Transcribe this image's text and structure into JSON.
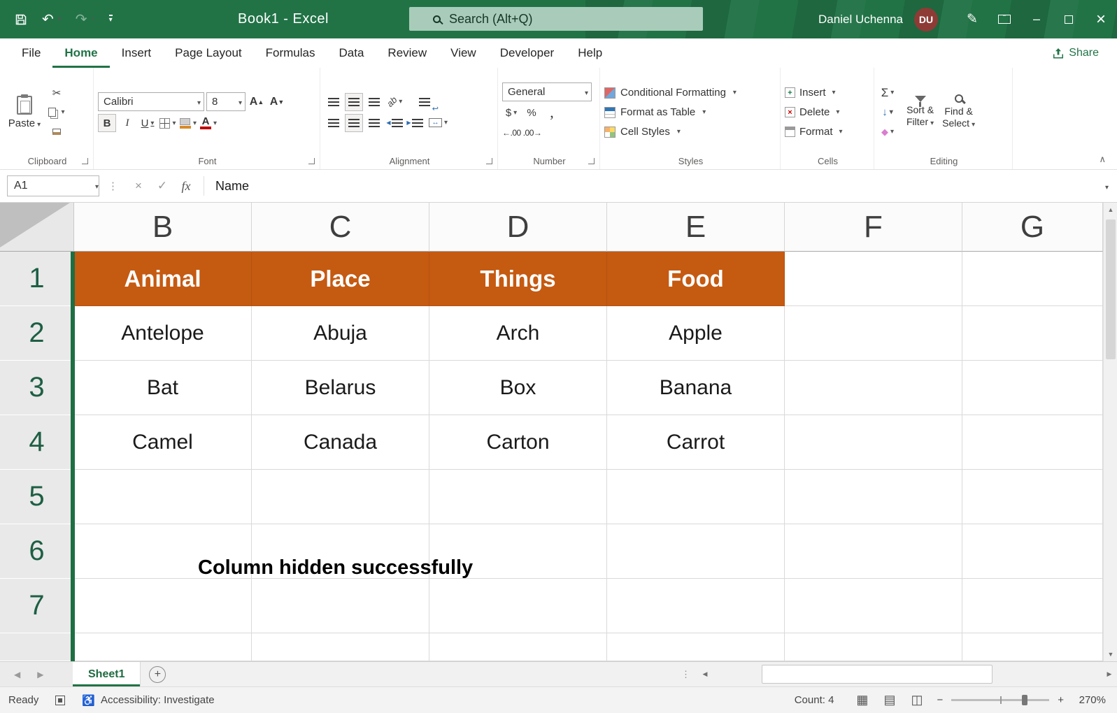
{
  "titlebar": {
    "title": "Book1 - Excel",
    "search_text": "Search (Alt+Q)",
    "user_name": "Daniel Uchenna",
    "avatar_initials": "DU"
  },
  "tabs": [
    "File",
    "Home",
    "Insert",
    "Page Layout",
    "Formulas",
    "Data",
    "Review",
    "View",
    "Developer",
    "Help"
  ],
  "share_label": "Share",
  "ribbon": {
    "paste_label": "Paste",
    "font_name": "Calibri",
    "font_size": "8",
    "bold": "B",
    "italic": "I",
    "underline": "U",
    "grow_font": "A",
    "shrink_font": "A",
    "number_format": "General",
    "currency": "$",
    "percent": "%",
    "comma": ",",
    "increase_decimal": "←.00",
    "decrease_decimal": ".00→",
    "conditional_formatting": "Conditional Formatting",
    "format_as_table": "Format as Table",
    "cell_styles": "Cell Styles",
    "insert_label": "Insert",
    "delete_label": "Delete",
    "format_label": "Format",
    "autosum": "Σ",
    "sort_line1": "Sort &",
    "sort_line2": "Filter",
    "find_line1": "Find &",
    "find_line2": "Select",
    "group_labels": [
      "Clipboard",
      "Font",
      "Alignment",
      "Number",
      "Styles",
      "Cells",
      "Editing"
    ]
  },
  "formula_bar": {
    "name_box": "A1",
    "fx": "fx",
    "content": "Name"
  },
  "sheet": {
    "col_headers": [
      "B",
      "C",
      "D",
      "E",
      "F",
      "G"
    ],
    "row_headers": [
      "1",
      "2",
      "3",
      "4",
      "5",
      "6",
      "7"
    ],
    "header_row": [
      "Animal",
      "Place",
      "Things",
      "Food"
    ],
    "data_rows": [
      [
        "Antelope",
        "Abuja",
        "Arch",
        "Apple"
      ],
      [
        "Bat",
        "Belarus",
        "Box",
        "Banana"
      ],
      [
        "Camel",
        "Canada",
        "Carton",
        "Carrot"
      ]
    ],
    "annotation": "Column hidden successfully"
  },
  "sheet_tabs": {
    "active_sheet": "Sheet1"
  },
  "status_bar": {
    "mode": "Ready",
    "accessibility": "Accessibility: Investigate",
    "count": "Count: 4",
    "zoom_level": "270%"
  },
  "icons": {
    "undo": "↶",
    "redo": "↷",
    "dropdown_chevron": "▾",
    "cut_scissors": "✂",
    "check": "✓",
    "cancel_x": "×",
    "fill_down_arrow": "↓",
    "clear_diamond": "◆",
    "merge_arrows": "↔",
    "wrap_return": "↩",
    "orientation_ab": "ab",
    "minimize": "–",
    "close": "×",
    "scroll_up": "▲",
    "scroll_down": "▼",
    "scroll_left": "◀",
    "scroll_right": "▶",
    "add_sheet": "+",
    "drag_dots": "⋮",
    "collapse_ribbon": "∧",
    "view_normal": "▦",
    "view_page_layout": "▤",
    "view_page_break": "◫",
    "zoom_out": "−",
    "zoom_in": "+",
    "accessibility_person": "♿",
    "indent_left": "◀",
    "indent_right": "▶"
  },
  "colors": {
    "excel_green": "#217346",
    "header_orange": "#C55A11",
    "hidden_column_line": "#1D6F42"
  }
}
